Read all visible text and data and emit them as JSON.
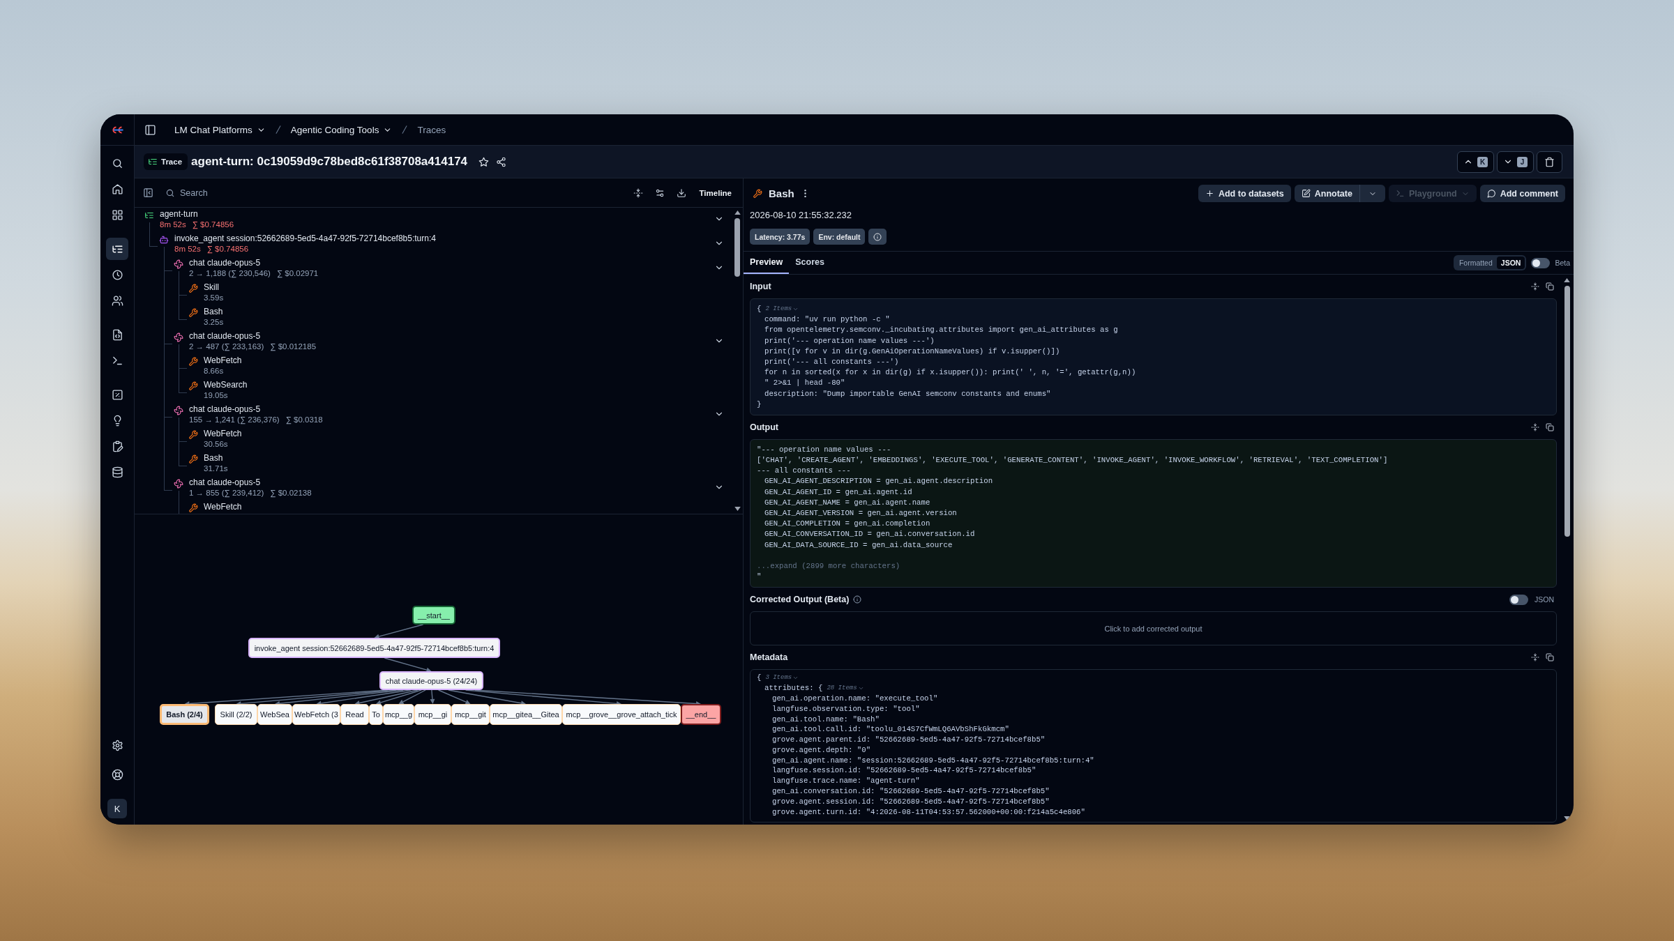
{
  "sidebar": {
    "items": [
      {
        "selected": false
      },
      {
        "selected": false
      },
      {
        "selected": false
      },
      {
        "selected": true
      },
      {
        "selected": false
      },
      {
        "selected": false
      },
      {
        "selected": false
      },
      {
        "selected": false
      },
      {
        "selected": false
      },
      {
        "selected": false
      },
      {
        "selected": false
      },
      {
        "selected": false
      }
    ],
    "bottom_items": [
      {
        "selected": false
      },
      {
        "selected": false
      }
    ],
    "avatar": "K"
  },
  "breadcrumbs": [
    {
      "label": "LM Chat Platforms",
      "dropdown": true,
      "current": false
    },
    {
      "label": "Agentic Coding Tools",
      "dropdown": true,
      "current": false
    },
    {
      "label": "Traces",
      "dropdown": false,
      "current": true
    }
  ],
  "header": {
    "badge": "Trace",
    "title": "agent-turn: 0c19059d9c78bed8c61f38708a414174",
    "starred": false,
    "shortcuts": [
      "K",
      "J"
    ]
  },
  "tree_toolbar": {
    "search": {
      "placeholder": "Search"
    },
    "view_button": "Timeline"
  },
  "tree": {
    "items": [
      {
        "name": "agent-turn",
        "kind": "trace",
        "details": [
          "8m 52s",
          "∑ $0.74856"
        ],
        "warning": true,
        "expanded": true,
        "children": [
          {
            "name": "invoke_agent session:52662689-5ed5-4a47-92f5-72714bcef8b5:turn:4",
            "kind": "agent",
            "details": [
              "8m 52s",
              "∑ $0.74856"
            ],
            "warning": true,
            "expanded": true,
            "children": [
              {
                "name": "chat claude-opus-5",
                "kind": "generation",
                "details": [
                  "2 → 1,188 (∑ 230,546)",
                  "∑ $0.02971"
                ],
                "warning": false,
                "expanded": true,
                "children": [
                  {
                    "name": "Skill",
                    "kind": "tool",
                    "details": [
                      "3.59s"
                    ],
                    "warning": false
                  },
                  {
                    "name": "Bash",
                    "kind": "tool",
                    "details": [
                      "3.25s"
                    ],
                    "warning": false
                  }
                ]
              },
              {
                "name": "chat claude-opus-5",
                "kind": "generation",
                "details": [
                  "2 → 487 (∑ 233,163)",
                  "∑ $0.012185"
                ],
                "warning": false,
                "expanded": true,
                "children": [
                  {
                    "name": "WebFetch",
                    "kind": "tool",
                    "details": [
                      "8.66s"
                    ],
                    "warning": false
                  },
                  {
                    "name": "WebSearch",
                    "kind": "tool",
                    "details": [
                      "19.05s"
                    ],
                    "warning": false
                  }
                ]
              },
              {
                "name": "chat claude-opus-5",
                "kind": "generation",
                "details": [
                  "155 → 1,241 (∑ 236,376)",
                  "∑ $0.0318"
                ],
                "warning": false,
                "expanded": true,
                "children": [
                  {
                    "name": "WebFetch",
                    "kind": "tool",
                    "details": [
                      "30.56s"
                    ],
                    "warning": false
                  },
                  {
                    "name": "Bash",
                    "kind": "tool",
                    "details": [
                      "31.71s"
                    ],
                    "warning": false
                  }
                ]
              },
              {
                "name": "chat claude-opus-5",
                "kind": "generation",
                "details": [
                  "1 → 855 (∑ 239,412)",
                  "∑ $0.02138"
                ],
                "warning": false,
                "expanded": true,
                "children": [
                  {
                    "name": "WebFetch",
                    "kind": "tool"
                  }
                ]
              }
            ]
          }
        ]
      }
    ]
  },
  "graph": {
    "nodes": [
      {
        "label": "__start__",
        "kind": "start",
        "selected": false
      },
      {
        "label": "invoke_agent session:52662689-5ed5-4a47-92f5-72714bcef8b5:turn:4",
        "kind": "agent",
        "selected": false
      },
      {
        "label": "chat claude-opus-5 (24/24)",
        "kind": "generation",
        "selected": false
      },
      {
        "label": "Bash (2/4)",
        "kind": "tool",
        "selected": true
      },
      {
        "label": "Skill (2/2)",
        "kind": "tool",
        "selected": false
      },
      {
        "label": "WebSea",
        "kind": "tool",
        "selected": false
      },
      {
        "label": "WebFetch (3",
        "kind": "tool",
        "selected": false
      },
      {
        "label": "Read",
        "kind": "tool",
        "selected": false
      },
      {
        "label": "To",
        "kind": "tool",
        "selected": false
      },
      {
        "label": "mcp__g",
        "kind": "tool",
        "selected": false
      },
      {
        "label": "mcp__gi",
        "kind": "tool",
        "selected": false
      },
      {
        "label": "mcp__git",
        "kind": "tool",
        "selected": false
      },
      {
        "label": "mcp__gitea__Gitea",
        "kind": "tool",
        "selected": false
      },
      {
        "label": "mcp__grove__grove_attach_tick",
        "kind": "tool",
        "selected": false
      },
      {
        "label": "__end__",
        "kind": "end",
        "selected": false
      }
    ]
  },
  "detail": {
    "kind": "tool",
    "name": "Bash",
    "actions": [
      {
        "label": "Add to datasets",
        "kind": "add",
        "disabled": false
      },
      {
        "label": "Annotate",
        "kind": "annotate",
        "disabled": false
      },
      {
        "label": "Playground",
        "kind": "playground",
        "disabled": true
      },
      {
        "label": "Add comment",
        "kind": "comment",
        "disabled": false
      }
    ],
    "timestamp": "2026-08-10 21:55:32.232",
    "badges": [
      "Latency: 3.77s",
      "Env: default"
    ],
    "tabs": [
      {
        "label": "Preview",
        "selected": true
      },
      {
        "label": "Scores",
        "selected": false
      }
    ],
    "view": {
      "options": [
        {
          "label": "Formatted",
          "selected": false
        },
        {
          "label": "JSON",
          "selected": true
        }
      ],
      "beta": {
        "label": "Beta",
        "on": false
      }
    },
    "input": {
      "title": "Input",
      "lines": [
        {
          "text": "{",
          "count": "2 Items",
          "children": [
            {
              "text": "command: \"uv run python -c \""
            },
            {
              "text": "from opentelemetry.semconv._incubating.attributes import gen_ai_attributes as g"
            },
            {
              "text": "print('--- operation name values ---')"
            },
            {
              "text": "print([v for v in dir(g.GenAiOperationNameValues) if v.isupper()])"
            },
            {
              "text": "print('--- all constants ---')"
            },
            {
              "text": "for n in sorted(x for x in dir(g) if x.isupper()): print(' ', n, '=', getattr(g,n))"
            },
            {
              "text": "\" 2>&1 | head -80\""
            },
            {
              "text": "description: \"Dump importable GenAI semconv constants and enums\""
            }
          ]
        },
        {
          "text": "}"
        }
      ]
    },
    "output": {
      "title": "Output",
      "lines": [
        {
          "text": "\"--- operation name values ---"
        },
        {
          "text": "['CHAT', 'CREATE_AGENT', 'EMBEDDINGS', 'EXECUTE_TOOL', 'GENERATE_CONTENT', 'INVOKE_AGENT', 'INVOKE_WORKFLOW', 'RETRIEVAL', 'TEXT_COMPLETION']"
        },
        {
          "text": "--- all constants ---",
          "children": [
            {
              "text": "GEN_AI_AGENT_DESCRIPTION = gen_ai.agent.description"
            },
            {
              "text": "GEN_AI_AGENT_ID = gen_ai.agent.id"
            },
            {
              "text": "GEN_AI_AGENT_NAME = gen_ai.agent.name"
            },
            {
              "text": "GEN_AI_AGENT_VERSION = gen_ai.agent.version"
            },
            {
              "text": "GEN_AI_COMPLETION = gen_ai.completion"
            },
            {
              "text": "GEN_AI_CONVERSATION_ID = gen_ai.conversation.id"
            },
            {
              "text": "GEN_AI_DATA_SOURCE_ID = gen_ai.data_source"
            }
          ]
        }
      ],
      "expand": "...expand (2899 more characters)",
      "closing": "\""
    },
    "corrected": {
      "title": "Corrected Output (Beta)",
      "json": {
        "label": "JSON",
        "on": false
      },
      "placeholder": "Click to add corrected output"
    },
    "metadata": {
      "title": "Metadata",
      "lines": [
        {
          "text": "{",
          "count": "3 Items",
          "children": [
            {
              "text": "attributes: {",
              "count": "28 Items",
              "children": [
                {
                  "text": "gen_ai.operation.name: \"execute_tool\""
                },
                {
                  "text": "langfuse.observation.type: \"tool\""
                },
                {
                  "text": "gen_ai.tool.name: \"Bash\""
                },
                {
                  "text": "gen_ai.tool.call.id: \"toolu_014S7CfWmLQ6AVbShFkGkmcm\""
                },
                {
                  "text": "grove.agent.parent.id: \"52662689-5ed5-4a47-92f5-72714bcef8b5\""
                },
                {
                  "text": "grove.agent.depth: \"0\""
                },
                {
                  "text": "gen_ai.agent.name: \"session:52662689-5ed5-4a47-92f5-72714bcef8b5:turn:4\""
                },
                {
                  "text": "langfuse.session.id: \"52662689-5ed5-4a47-92f5-72714bcef8b5\""
                },
                {
                  "text": "langfuse.trace.name: \"agent-turn\""
                },
                {
                  "text": "gen_ai.conversation.id: \"52662689-5ed5-4a47-92f5-72714bcef8b5\""
                },
                {
                  "text": "grove.agent.session.id: \"52662689-5ed5-4a47-92f5-72714bcef8b5\""
                },
                {
                  "text": "grove.agent.turn.id: \"4:2026-08-11T04:53:57.562000+00:00:f214a5c4e806\""
                }
              ]
            }
          ]
        }
      ]
    }
  }
}
